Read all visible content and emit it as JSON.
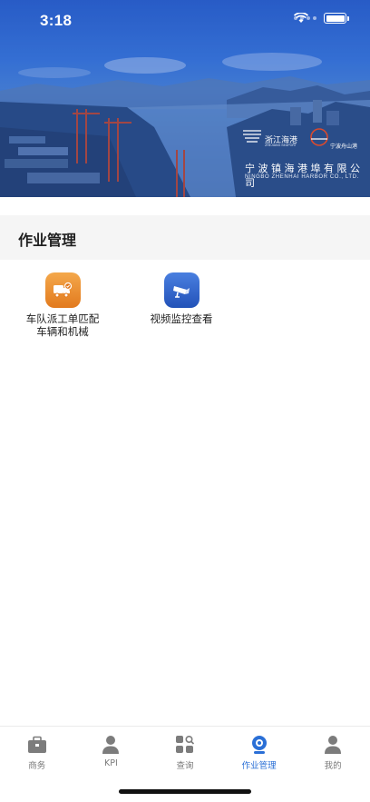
{
  "status_bar": {
    "time": "3:18"
  },
  "banner": {
    "brand_zj": "浙江海港",
    "brand_zj_en": "ZHEJIANG SEAPORT",
    "brand_nb": "宁波舟山港",
    "company_cn": "宁波镇海港埠有限公司",
    "company_en": "NINGBO ZHENHAI HARBOR CO., LTD."
  },
  "section": {
    "title": "作业管理"
  },
  "grid": [
    {
      "label": "车队派工单匹配车辆和机械",
      "icon": "truck-icon",
      "color": "#e8872a"
    },
    {
      "label": "视频监控查看",
      "icon": "cctv-camera-icon",
      "color": "#2f60c4"
    }
  ],
  "tabbar": {
    "active_color": "#2a6fd6",
    "inactive_color": "#7a7a7a",
    "tabs": [
      {
        "label": "商务",
        "icon": "briefcase-icon"
      },
      {
        "label": "KPI",
        "icon": "person-icon"
      },
      {
        "label": "查询",
        "icon": "grid-search-icon"
      },
      {
        "label": "作业管理",
        "icon": "webcam-icon"
      },
      {
        "label": "我的",
        "icon": "user-icon"
      }
    ]
  }
}
